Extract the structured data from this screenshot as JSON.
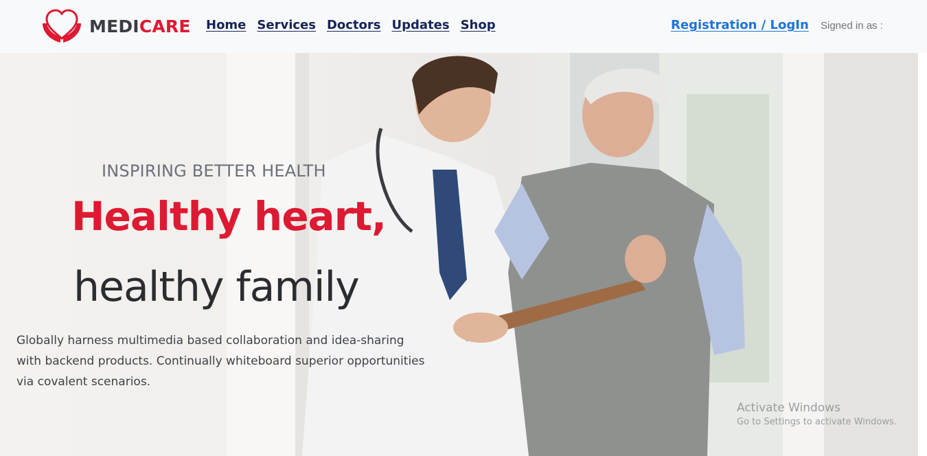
{
  "brand": {
    "part1": "MEDI",
    "part2": "CARE",
    "dark_color": "#3a3d44",
    "accent_color": "#dd1a32",
    "icon": "hands-heart-icon"
  },
  "nav": {
    "items": [
      {
        "label": "Home"
      },
      {
        "label": "Services"
      },
      {
        "label": "Doctors"
      },
      {
        "label": "Updates"
      },
      {
        "label": "Shop"
      }
    ],
    "register_label": "Registration / LogIn",
    "signed_in_label": "Signed in as :"
  },
  "hero": {
    "eyebrow": "INSPIRING BETTER HEALTH",
    "title_line1": "Healthy heart,",
    "title_line2": "healthy family",
    "body": "Globally harness multimedia based collaboration and idea-sharing with backend products. Continually whiteboard superior opportunities via covalent scenarios."
  },
  "watermark": {
    "line1": "Activate Windows",
    "line2": "Go to Settings to activate Windows."
  },
  "colors": {
    "nav_link": "#152458",
    "register_link": "#1e74d8",
    "navbar_bg": "#f8f9fa"
  }
}
